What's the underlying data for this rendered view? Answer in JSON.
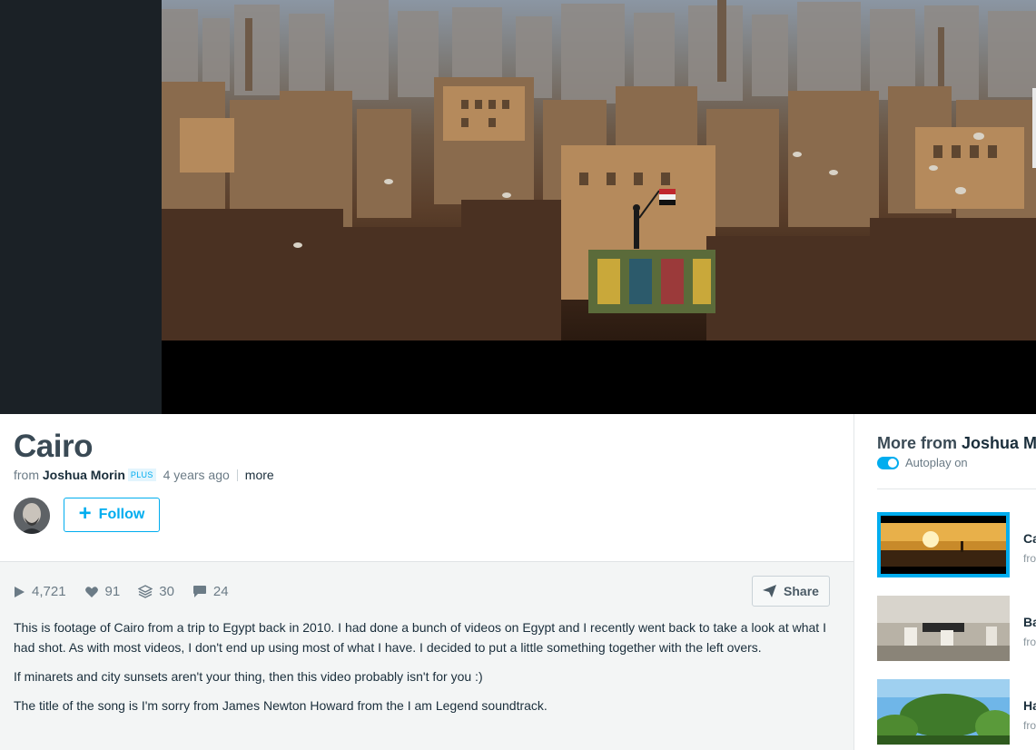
{
  "video": {
    "title": "Cairo",
    "from_label": "from",
    "author": "Joshua Morin",
    "badge": "PLUS",
    "age": "4 years ago",
    "more_label": "more",
    "follow_label": "Follow"
  },
  "stats": {
    "plays": "4,721",
    "likes": "91",
    "collections": "30",
    "comments": "24",
    "share_label": "Share"
  },
  "description": [
    "This is footage of Cairo from a trip to Egypt back in 2010. I had done a bunch of videos on Egypt and I recently went back to take a look at what I had shot. As with most videos, I don't end up using most of what I have. I decided to put a little something together with the left overs.",
    "If minarets and city sunsets aren't your thing, then this video probably isn't for you :)",
    "The title of the song is I'm sorry from James Newton Howard from the I am Legend soundtrack."
  ],
  "sidebar": {
    "title_prefix": "More from",
    "title_name": "Joshua M",
    "autoplay_label": "Autoplay on",
    "items": [
      {
        "title": "Ca",
        "sub": "fro"
      },
      {
        "title": "Ba",
        "sub": "fro"
      },
      {
        "title": "Ha",
        "sub": "fro"
      }
    ]
  },
  "colors": {
    "accent": "#00adef",
    "text_dark": "#1a2e3b",
    "text_muted": "#6b7b86"
  }
}
